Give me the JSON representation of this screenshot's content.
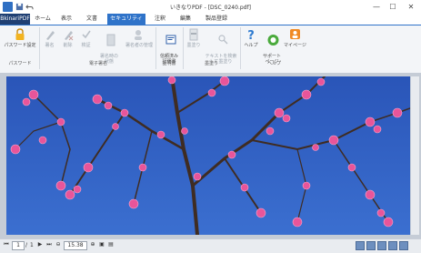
{
  "window": {
    "title": "いきなりPDF - [DSC_0240.pdf]",
    "controls": {
      "minimize": "—",
      "maximize": "☐",
      "close": "✕"
    }
  },
  "brand": "BkinariPDF",
  "tabs": [
    {
      "label": "ホーム",
      "active": false
    },
    {
      "label": "表示",
      "active": false
    },
    {
      "label": "文書",
      "active": false
    },
    {
      "label": "セキュリティ",
      "active": true
    },
    {
      "label": "注釈",
      "active": false
    },
    {
      "label": "編集",
      "active": false
    },
    {
      "label": "製品登録",
      "active": false
    }
  ],
  "ribbon": {
    "groups": [
      {
        "label": "パスワード",
        "buttons": [
          {
            "label": "パスワード設定",
            "icon": "lock-icon",
            "enabled": true
          }
        ]
      },
      {
        "label": "電子署名",
        "buttons": [
          {
            "label": "署名",
            "icon": "pen-icon",
            "enabled": false
          },
          {
            "label": "削除",
            "icon": "pen-delete-icon",
            "enabled": false
          },
          {
            "label": "検証",
            "icon": "check-icon",
            "enabled": false
          },
          {
            "label": "署名時の\n状態",
            "icon": "document-icon",
            "enabled": false
          },
          {
            "label": "署名者の管理",
            "icon": "user-gear-icon",
            "enabled": false
          }
        ]
      },
      {
        "label": "証明書",
        "buttons": [
          {
            "label": "信頼済み\n証明書",
            "icon": "certificate-icon",
            "enabled": true
          }
        ]
      },
      {
        "label": "墨塗り",
        "buttons": [
          {
            "label": "墨塗り",
            "icon": "redact-icon",
            "enabled": false
          },
          {
            "label": "テキストを検索\nして墨塗り",
            "icon": "search-redact-icon",
            "enabled": false
          }
        ]
      },
      {
        "label": "ヘルプ",
        "buttons": [
          {
            "label": "ヘルプ",
            "icon": "help-icon",
            "enabled": true
          },
          {
            "label": "サポート\nページ",
            "icon": "support-icon",
            "enabled": true
          },
          {
            "label": "マイページ",
            "icon": "mypage-icon",
            "enabled": true
          }
        ]
      }
    ]
  },
  "status": {
    "page_current": "1",
    "page_separator": "/",
    "page_total": "1",
    "zoom_value": "15.38"
  },
  "colors": {
    "accent": "#2f73c9",
    "sky": "#2f5fc0",
    "blossom": "#e8559a",
    "branch": "#4a3428"
  }
}
